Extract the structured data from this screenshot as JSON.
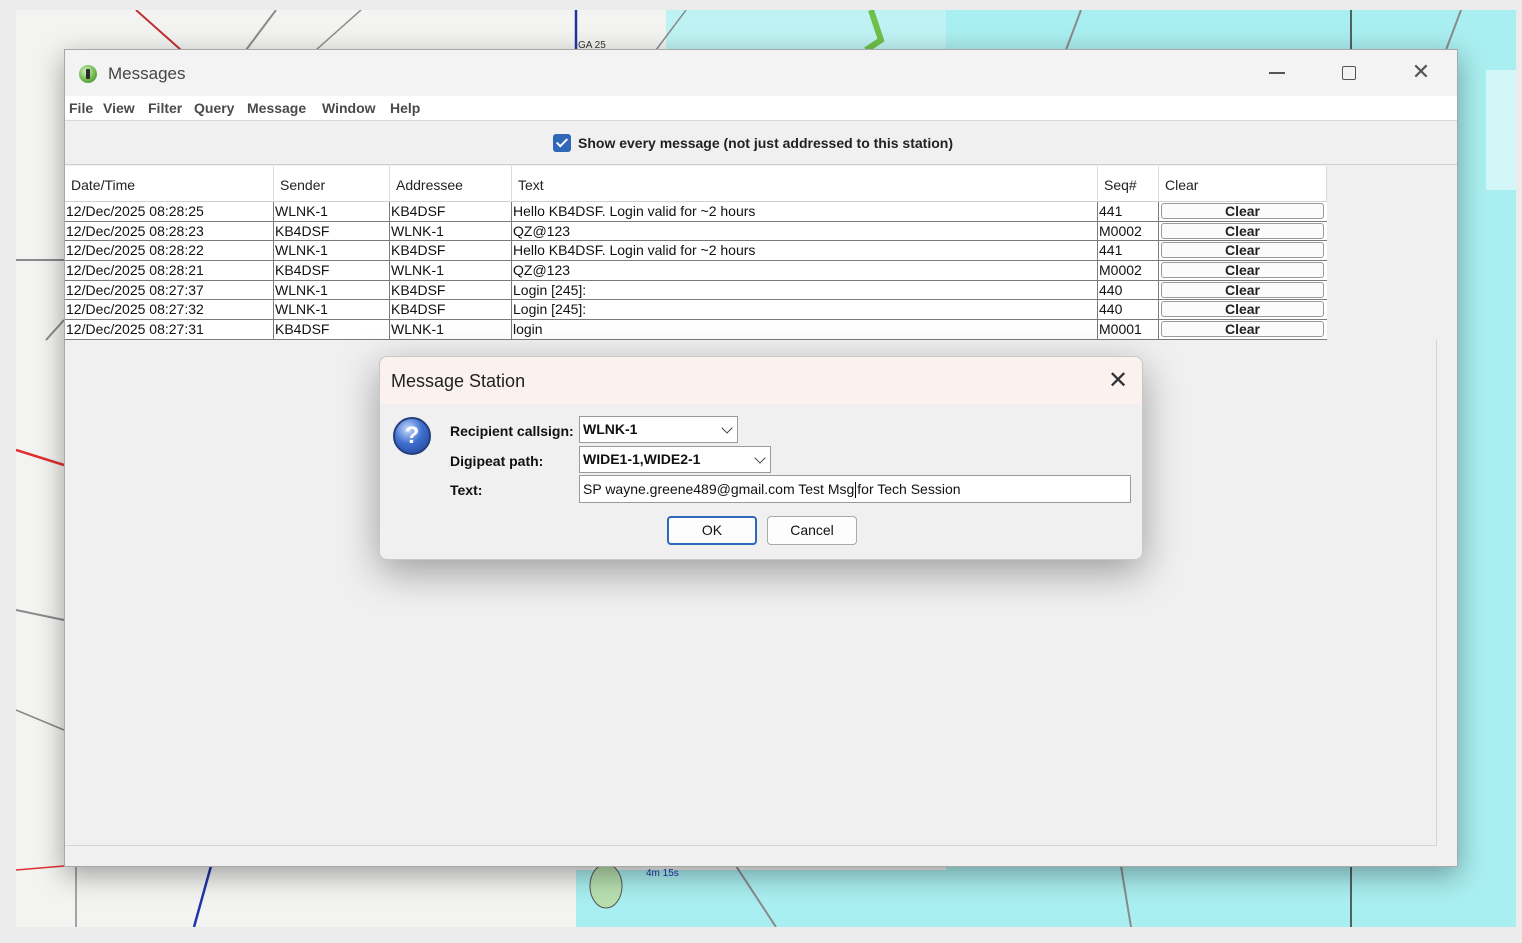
{
  "window": {
    "title": "Messages",
    "min_glyph": "",
    "close_glyph": "✕"
  },
  "menu": [
    "File",
    "View",
    "Filter",
    "Query",
    "Message",
    "Window",
    "Help"
  ],
  "filter": {
    "checked": true,
    "label": "Show every message (not just addressed to this station)"
  },
  "table": {
    "columns": [
      "Date/Time",
      "Sender",
      "Addressee",
      "Text",
      "Seq#",
      "Clear"
    ],
    "rows": [
      {
        "datetime": "12/Dec/2025 08:28:25",
        "sender": "WLNK-1",
        "addressee": "KB4DSF",
        "text": "Hello KB4DSF. Login valid for ~2 hours",
        "seq": "441",
        "clear": "Clear"
      },
      {
        "datetime": "12/Dec/2025 08:28:23",
        "sender": "KB4DSF",
        "addressee": "WLNK-1",
        "text": "QZ@123",
        "seq": "M0002",
        "clear": "Clear"
      },
      {
        "datetime": "12/Dec/2025 08:28:22",
        "sender": "WLNK-1",
        "addressee": "KB4DSF",
        "text": "Hello KB4DSF. Login valid for ~2 hours",
        "seq": "441",
        "clear": "Clear"
      },
      {
        "datetime": "12/Dec/2025 08:28:21",
        "sender": "KB4DSF",
        "addressee": "WLNK-1",
        "text": "QZ@123",
        "seq": "M0002",
        "clear": "Clear"
      },
      {
        "datetime": "12/Dec/2025 08:27:37",
        "sender": "WLNK-1",
        "addressee": "KB4DSF",
        "text": "Login [245]:",
        "seq": "440",
        "clear": "Clear"
      },
      {
        "datetime": "12/Dec/2025 08:27:32",
        "sender": "WLNK-1",
        "addressee": "KB4DSF",
        "text": "Login [245]:",
        "seq": "440",
        "clear": "Clear"
      },
      {
        "datetime": "12/Dec/2025 08:27:31",
        "sender": "KB4DSF",
        "addressee": "WLNK-1",
        "text": "login",
        "seq": "M0001",
        "clear": "Clear"
      }
    ]
  },
  "dialog": {
    "title": "Message Station",
    "icon": "question-icon",
    "icon_glyph": "?",
    "close_glyph": "✕",
    "recipient_label": "Recipient callsign:",
    "recipient_value": "WLNK-1",
    "path_label": "Digipeat path:",
    "path_value": "WIDE1-1,WIDE2-1",
    "text_label": "Text:",
    "text_before_caret": "SP wayne.greene489@gmail.com Test Msg",
    "text_after_caret": "for Tech Session",
    "ok_label": "OK",
    "cancel_label": "Cancel"
  },
  "map": {
    "water_color": "#a9eef0",
    "road_color": "#8a8a8a",
    "route_color": "#2333a8",
    "highway_color": "#e03030",
    "labels": [
      "GA 25",
      "4m 15s"
    ]
  }
}
